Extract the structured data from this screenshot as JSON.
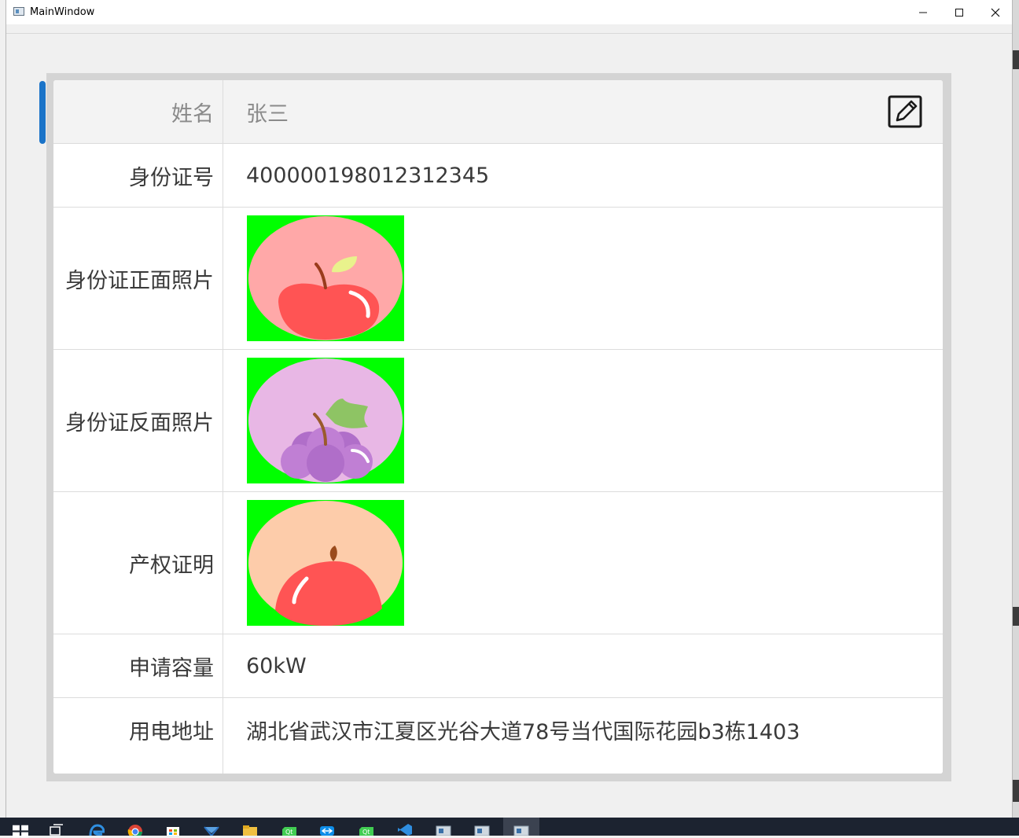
{
  "window": {
    "title": "MainWindow",
    "min_glyph": "—",
    "max_glyph": "☐",
    "close_glyph": "✕"
  },
  "form": {
    "header": {
      "label": "姓名",
      "value": "张三",
      "edit_icon": "edit-icon"
    },
    "rows": [
      {
        "label": "身份证号",
        "value": "400000198012312345"
      },
      {
        "label": "身份证正面照片",
        "image": "apple-image"
      },
      {
        "label": "身份证反面照片",
        "image": "grape-image"
      },
      {
        "label": "产权证明",
        "image": "peach-image"
      },
      {
        "label": "申请容量",
        "value": "60kW"
      },
      {
        "label": "用电地址",
        "value": "湖北省武汉市江夏区光谷大道78号当代国际花园b3栋1403"
      }
    ]
  },
  "colors": {
    "photo_background": "#00ff00",
    "scroll_accent": "#1a73c8",
    "apple_bg": "#ffa8a8",
    "grape_bg": "#e8b7e5",
    "peach_bg": "#fdccaa",
    "fruit_red": "#ff5454"
  },
  "taskbar": {
    "icons": [
      "windows-start-icon",
      "task-view-icon",
      "edge-icon",
      "chrome-icon",
      "store-icon",
      "mail-icon",
      "explorer-icon",
      "qt-icon",
      "teamviewer-icon",
      "qt-icon-2",
      "vscode-icon",
      "app-window-icon",
      "app-window-icon-2",
      "app-window-icon-3"
    ]
  }
}
